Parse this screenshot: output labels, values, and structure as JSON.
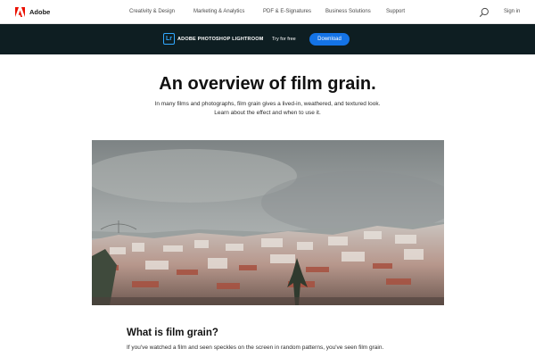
{
  "colors": {
    "brand_red": "#eb1000",
    "nav_dark": "#0e1e22",
    "accent_blue": "#1473e6",
    "lightroom_blue": "#31a8ff"
  },
  "global_nav": {
    "brand": "Adobe",
    "logo_icon": "adobe-logo-icon",
    "links": [
      "Creativity & Design",
      "Marketing & Analytics",
      "PDF & E-Signatures",
      "Business Solutions",
      "Support"
    ],
    "search_icon": "search-icon",
    "sign_in": "Sign in"
  },
  "product_bar": {
    "badge": "Lr",
    "product_name": "ADOBE PHOTOSHOP LIGHTROOM",
    "try_link": "Try for free",
    "download_button": "Download"
  },
  "hero": {
    "headline": "An overview of film grain.",
    "intro_lines": [
      "In many films and photographs, film grain gives a lived-in, weathered, and textured look.",
      "Learn about the effect and when to use it."
    ]
  },
  "section": {
    "title": "What is film grain?",
    "text": "If you've watched a film and seen speckles on the screen in random patterns, you've seen film grain."
  }
}
